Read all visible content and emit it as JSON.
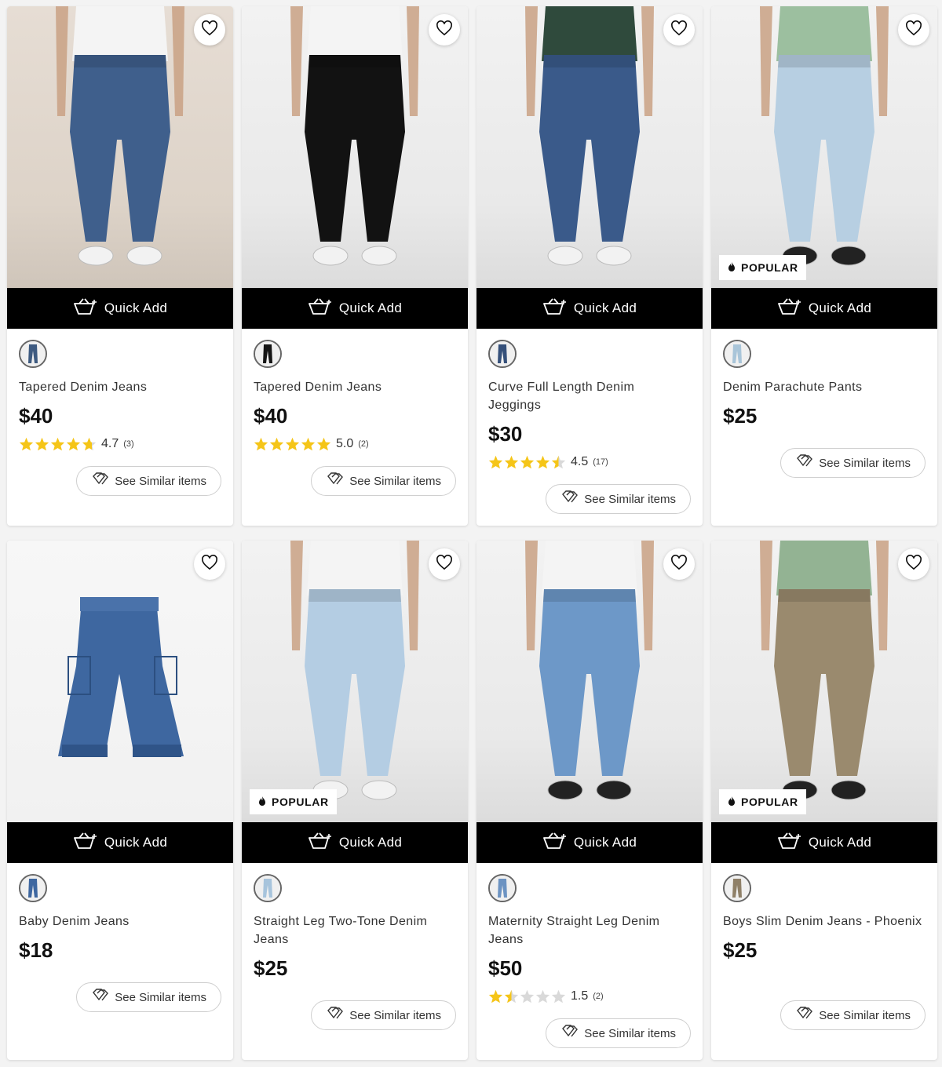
{
  "quick_add_label": "Quick Add",
  "see_similar_label": "See Similar items",
  "popular_label": "POPULAR",
  "colors": {
    "star": "#f5c518",
    "star_empty": "#d9d9d9",
    "button_bg": "#000000"
  },
  "products": [
    {
      "name": "Tapered Denim Jeans",
      "price": "$40",
      "rating": 4.7,
      "rating_text": "4.7",
      "review_count": "(3)",
      "popular": false,
      "swatch_color": "#3d5a80"
    },
    {
      "name": "Tapered Denim Jeans",
      "price": "$40",
      "rating": 5.0,
      "rating_text": "5.0",
      "review_count": "(2)",
      "popular": false,
      "swatch_color": "#151515"
    },
    {
      "name": "Curve Full Length Denim Jeggings",
      "price": "$30",
      "rating": 4.5,
      "rating_text": "4.5",
      "review_count": "(17)",
      "popular": false,
      "swatch_color": "#35507a"
    },
    {
      "name": "Denim Parachute Pants",
      "price": "$25",
      "rating": null,
      "rating_text": "",
      "review_count": "",
      "popular": true,
      "swatch_color": "#a9c5d9"
    },
    {
      "name": "Baby Denim Jeans",
      "price": "$18",
      "rating": null,
      "rating_text": "",
      "review_count": "",
      "popular": false,
      "swatch_color": "#3e67a0"
    },
    {
      "name": "Straight Leg Two-Tone Denim Jeans",
      "price": "$25",
      "rating": null,
      "rating_text": "",
      "review_count": "",
      "popular": true,
      "swatch_color": "#a7c4dc"
    },
    {
      "name": "Maternity Straight Leg Denim Jeans",
      "price": "$50",
      "rating": 1.5,
      "rating_text": "1.5",
      "review_count": "(2)",
      "popular": false,
      "swatch_color": "#6c93c2"
    },
    {
      "name": "Boys Slim Denim Jeans - Phoenix",
      "price": "$25",
      "rating": null,
      "rating_text": "",
      "review_count": "",
      "popular": true,
      "swatch_color": "#8f8068"
    }
  ]
}
